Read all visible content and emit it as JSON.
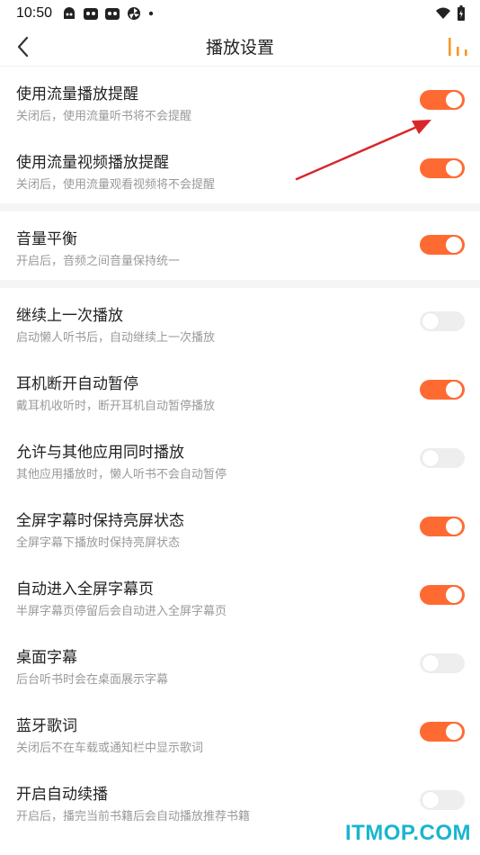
{
  "status_bar": {
    "time": "10:50"
  },
  "header": {
    "title": "播放设置"
  },
  "sections": [
    {
      "rows": [
        {
          "title": "使用流量播放提醒",
          "desc": "关闭后，使用流量听书将不会提醒",
          "on": true
        },
        {
          "title": "使用流量视频播放提醒",
          "desc": "关闭后，使用流量观看视频将不会提醒",
          "on": true
        }
      ]
    },
    {
      "rows": [
        {
          "title": "音量平衡",
          "desc": "开启后，音频之间音量保持统一",
          "on": true
        }
      ]
    },
    {
      "rows": [
        {
          "title": "继续上一次播放",
          "desc": "启动懒人听书后，自动继续上一次播放",
          "on": false
        },
        {
          "title": "耳机断开自动暂停",
          "desc": "戴耳机收听时，断开耳机自动暂停播放",
          "on": true
        },
        {
          "title": "允许与其他应用同时播放",
          "desc": "其他应用播放时，懒人听书不会自动暂停",
          "on": false
        },
        {
          "title": "全屏字幕时保持亮屏状态",
          "desc": "全屏字幕下播放时保持亮屏状态",
          "on": true
        },
        {
          "title": "自动进入全屏字幕页",
          "desc": "半屏字幕页停留后会自动进入全屏字幕页",
          "on": true
        },
        {
          "title": "桌面字幕",
          "desc": "后台听书时会在桌面展示字幕",
          "on": false
        },
        {
          "title": "蓝牙歌词",
          "desc": "关闭后不在车载或通知栏中显示歌词",
          "on": true
        },
        {
          "title": "开启自动续播",
          "desc": "开启后，播完当前书籍后会自动播放推荐书籍",
          "on": false
        }
      ]
    }
  ],
  "watermark": "ITMOP.COM",
  "colors": {
    "accent": "#ff6a33",
    "toggle_off": "#eeeeee",
    "annotation_arrow": "#d9262b",
    "watermark": "#19b5cf"
  },
  "icons": {
    "back": "chevron-left-icon",
    "bars": "audio-bars-icon"
  }
}
